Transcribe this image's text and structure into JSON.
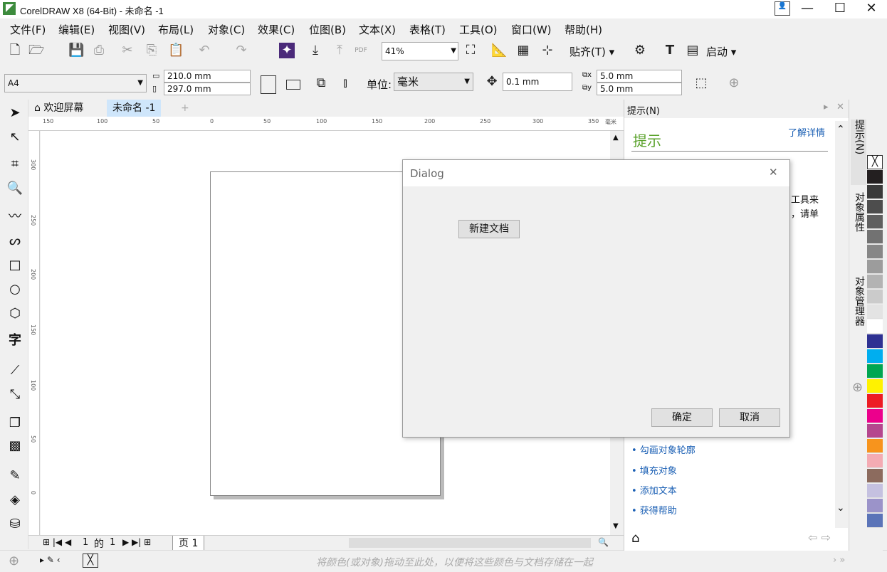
{
  "window": {
    "title": "CorelDRAW X8 (64-Bit) - 未命名 -1",
    "minimize": "—",
    "maximize": "☐",
    "close": "✕"
  },
  "menu": [
    "文件(F)",
    "编辑(E)",
    "视图(V)",
    "布局(L)",
    "对象(C)",
    "效果(C)",
    "位图(B)",
    "文本(X)",
    "表格(T)",
    "工具(O)",
    "窗口(W)",
    "帮助(H)"
  ],
  "toolbar": {
    "zoom": "41%",
    "snap_label": "贴齐(T)",
    "launch_label": "启动"
  },
  "propbar": {
    "page_size": "A4",
    "width": "210.0 mm",
    "height": "297.0 mm",
    "unit_label": "单位:",
    "unit": "毫米",
    "nudge": "0.1 mm",
    "dup_x": "5.0 mm",
    "dup_y": "5.0 mm"
  },
  "doc_tabs": {
    "welcome": "欢迎屏幕",
    "doc": "未命名 -1",
    "add": "+"
  },
  "ruler": {
    "h_ticks": [
      "150",
      "100",
      "50",
      "0",
      "50",
      "100",
      "150",
      "200",
      "250",
      "300",
      "350"
    ],
    "unit": "毫米",
    "v_ticks": [
      "300",
      "250",
      "200",
      "150",
      "100",
      "50",
      "0"
    ]
  },
  "page_nav": {
    "current": "1",
    "of_label": "的",
    "total": "1",
    "page_tab": "页 1"
  },
  "status": {
    "hint": "将颜色(或对象)拖动至此处，以便将这些颜色与文档存储在一起"
  },
  "docker": {
    "header": "提示(N)",
    "title": "提示",
    "learn_more": "了解详情",
    "partial1": "工具来",
    "partial2": "，请单",
    "links": [
      "• 勾画对象轮廓",
      "• 填充对象",
      "• 添加文本",
      "• 获得帮助"
    ]
  },
  "side_tabs": [
    "提示(N)",
    "对象属性",
    "对象管理器"
  ],
  "palette": [
    "#ffffff",
    "#231f20",
    "#3a3a3a",
    "#4d4d4d",
    "#5f5f5f",
    "#727272",
    "#878787",
    "#9c9c9c",
    "#b3b3b3",
    "#cbcbcb",
    "#e3e3e3",
    "#ffffff",
    "#2e3192",
    "#00aeef",
    "#00a651",
    "#fff200",
    "#ed1c24",
    "#ec008c",
    "#b5478e",
    "#f7941d",
    "#f4abb3",
    "#8c6b5e",
    "#c5c1e0",
    "#9b93c9",
    "#5b74b8"
  ],
  "dialog": {
    "title": "Dialog",
    "new_doc": "新建文档",
    "ok": "确定",
    "cancel": "取消",
    "close": "✕"
  }
}
